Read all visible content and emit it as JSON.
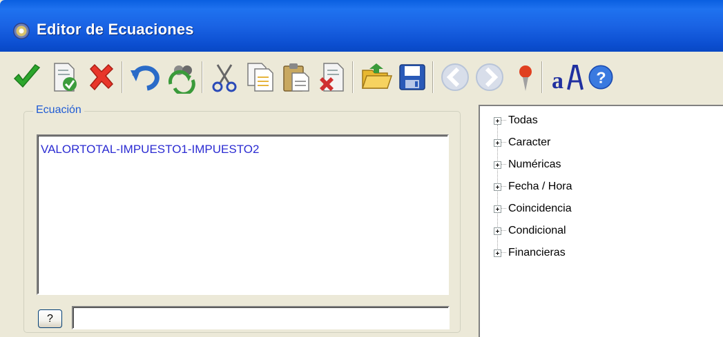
{
  "window": {
    "title": "Editor de Ecuaciones"
  },
  "toolbar": {
    "buttons": [
      {
        "name": "accept-icon",
        "color": "#2ca62c"
      },
      {
        "name": "validate-document-icon",
        "color": "#3c9c3c"
      },
      {
        "name": "cancel-icon",
        "color": "#e8362a"
      },
      {
        "name": "undo-icon",
        "color": "#2a6bc8"
      },
      {
        "name": "refresh-icon",
        "color": "#3a9a3a"
      },
      {
        "name": "cut-icon",
        "color": "#555555"
      },
      {
        "name": "copy-icon",
        "color": "#e6b43c"
      },
      {
        "name": "paste-icon",
        "color": "#b8a060"
      },
      {
        "name": "delete-document-icon",
        "color": "#d03030"
      },
      {
        "name": "open-folder-icon",
        "color": "#f0c040"
      },
      {
        "name": "save-icon",
        "color": "#2a5ab8"
      },
      {
        "name": "back-arrow-icon",
        "color": "#b8c4d8"
      },
      {
        "name": "forward-arrow-icon",
        "color": "#b8c4d8"
      },
      {
        "name": "pushpin-icon",
        "color": "#e04020"
      },
      {
        "name": "font-icon",
        "color": "#2030a0"
      },
      {
        "name": "help-icon",
        "color": "#3a7ae0"
      }
    ]
  },
  "equation": {
    "group_label": "Ecuación",
    "text": "VALORTOTAL-IMPUESTO1-IMPUESTO2",
    "help_button": "?",
    "status_value": ""
  },
  "tree": {
    "items": [
      {
        "label": "Todas"
      },
      {
        "label": "Caracter"
      },
      {
        "label": "Numéricas"
      },
      {
        "label": "Fecha / Hora"
      },
      {
        "label": "Coincidencia"
      },
      {
        "label": "Condicional"
      },
      {
        "label": "Financieras"
      }
    ]
  }
}
